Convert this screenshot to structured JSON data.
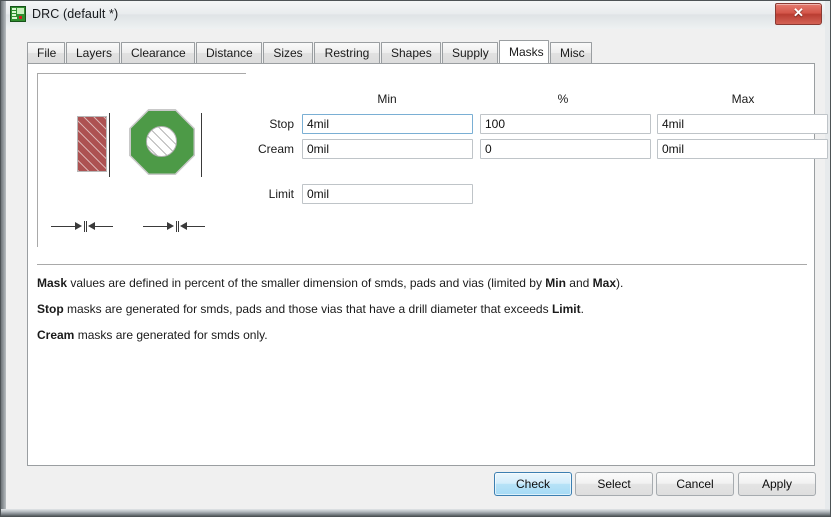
{
  "window": {
    "title": "DRC (default *)",
    "icon": "pcb-board-icon",
    "close_label": "✕"
  },
  "tabs": [
    {
      "label": "File",
      "active": false
    },
    {
      "label": "Layers",
      "active": false
    },
    {
      "label": "Clearance",
      "active": false
    },
    {
      "label": "Distance",
      "active": false
    },
    {
      "label": "Sizes",
      "active": false
    },
    {
      "label": "Restring",
      "active": false
    },
    {
      "label": "Shapes",
      "active": false
    },
    {
      "label": "Supply",
      "active": false
    },
    {
      "label": "Masks",
      "active": true
    },
    {
      "label": "Misc",
      "active": false
    }
  ],
  "masks": {
    "columns": [
      "Min",
      "%",
      "Max"
    ],
    "rows": [
      {
        "label": "Stop",
        "min": "4mil",
        "percent": "100",
        "max": "4mil",
        "focused_field": "min"
      },
      {
        "label": "Cream",
        "min": "0mil",
        "percent": "0",
        "max": "0mil",
        "focused_field": ""
      }
    ],
    "limit": {
      "label": "Limit",
      "value": "0mil"
    },
    "placeholder": ""
  },
  "graphic": {
    "smd_label": "smd-rectangle",
    "pad_label": "octagon-pad",
    "colors": {
      "smd_red": "#ad5252",
      "pad_green": "#4d9a47",
      "outline_gray": "#c9c9c9",
      "dimension_dark": "#3a3a3a"
    }
  },
  "help": [
    {
      "bold": "Mask",
      "text": " values are defined in percent of the smaller dimension of smds, pads and vias (limited by ",
      "bold2": "Min",
      "text2": " and ",
      "bold3": "Max",
      "text3": ")."
    },
    {
      "bold": "Stop",
      "text": " masks are generated for smds, pads and those vias that have a drill diameter that exceeds ",
      "bold2": "Limit",
      "text2": ".",
      "bold3": "",
      "text3": ""
    },
    {
      "bold": "Cream",
      "text": " masks are generated for smds only.",
      "bold2": "",
      "text2": "",
      "bold3": "",
      "text3": ""
    }
  ],
  "buttons": [
    {
      "label": "Check",
      "default": true
    },
    {
      "label": "Select",
      "default": false
    },
    {
      "label": "Cancel",
      "default": false
    },
    {
      "label": "Apply",
      "default": false
    }
  ],
  "accent": {
    "focus_blue": "#7aafd4",
    "default_btn_blue": "#3c7fb1",
    "close_red": "#b93d32"
  }
}
